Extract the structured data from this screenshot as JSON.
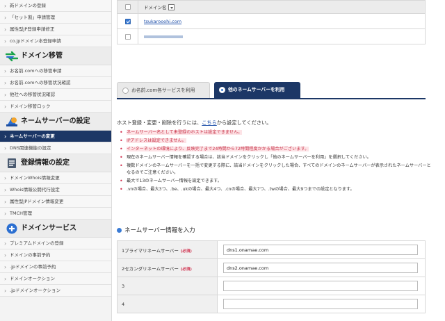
{
  "sidebar": {
    "top_items": [
      "新ドメインの登録",
      "「セット割」申請管理",
      "属性型JP登録申請修正",
      "co.jpドメイン本登録申請"
    ],
    "sections": [
      {
        "title": "ドメイン移管",
        "icon": "transfer-arrows-icon",
        "items": [
          "お名前.comへの移管申請",
          "お名前.comへの移管状況確認",
          "他社への移管状況確認",
          "ドメイン移管ロック"
        ]
      },
      {
        "title": "ネームサーバーの設定",
        "icon": "name-server-icon",
        "items": [
          "ネームサーバーの変更",
          "DNS関連機能の設定"
        ],
        "active_index": 0
      },
      {
        "title": "登録情報の設定",
        "icon": "registration-info-icon",
        "items": [
          "ドメインWhois情報変更",
          "Whois情報公開代行設定",
          "属性型JPドメイン情報変更",
          "TMCH管理"
        ]
      },
      {
        "title": "ドメインサービス",
        "icon": "plus-circle-icon",
        "items": [
          "プレミアムドメインの登録",
          "ドメインの事前予約",
          ".jpドメインの事前予約",
          "ドメインオークション",
          ".jpドメインオークション"
        ]
      }
    ]
  },
  "domain_table": {
    "header": "ドメイン名",
    "rows": [
      {
        "name": "tsukarooohi.com",
        "checked": true,
        "blurred": false
      },
      {
        "name": "",
        "checked": false,
        "blurred": true
      }
    ]
  },
  "tabs": [
    {
      "label": "お名前.com各サービスを利用",
      "active": false
    },
    {
      "label": "他のネームサーバーを利用",
      "active": true
    }
  ],
  "intro": {
    "before": "ホスト登録・変更・削除を行うには、",
    "link": "こちら",
    "after": "から設定してください。"
  },
  "notes": [
    {
      "text": "ネームサーバー名として未登録のホストは設定できません。",
      "highlight": true
    },
    {
      "text": "IPアドレスは設定できません。",
      "highlight": true
    },
    {
      "text": "インターネットの環境により、反映完了まで24時間から72時間程度かかる場合がございます。",
      "highlight": true
    },
    {
      "text": "現在のネームサーバー情報を確認する場合は、該当ドメインをクリックし「他のネームサーバーを利用」を選択してください。",
      "highlight": false
    },
    {
      "text": "複数ドメインのネームサーバーを一括で変更する際に、該当ドメインをクリックした場合、すべてのドメインのネームサーバーが表示されたネームサーバーとなるのでご注意ください。",
      "highlight": false
    },
    {
      "text": "最大で13のネームサーバー情報を設定できます。",
      "highlight": false
    },
    {
      "text": ".vnの場合、最大3つ、.be、.ukの場合、最大4つ、.cnの場合、最大7つ、.twの場合、最大9つまでの設定となります。",
      "highlight": false
    }
  ],
  "ns_section_title": "ネームサーバー情報を入力",
  "ns_rows": [
    {
      "label": "1プライマリネームサーバー",
      "required": "(必須)",
      "value": "dns1.onamae.com"
    },
    {
      "label": "2セカンダリネームサーバー",
      "required": "(必須)",
      "value": "dns2.onamae.com"
    },
    {
      "label": "3",
      "required": "",
      "value": ""
    },
    {
      "label": "4",
      "required": "",
      "value": ""
    }
  ],
  "colors": {
    "navy": "#1c3766",
    "accent_blue": "#3a7bd5",
    "warning_red": "#d0314e",
    "warning_bg": "#fde3e6"
  }
}
